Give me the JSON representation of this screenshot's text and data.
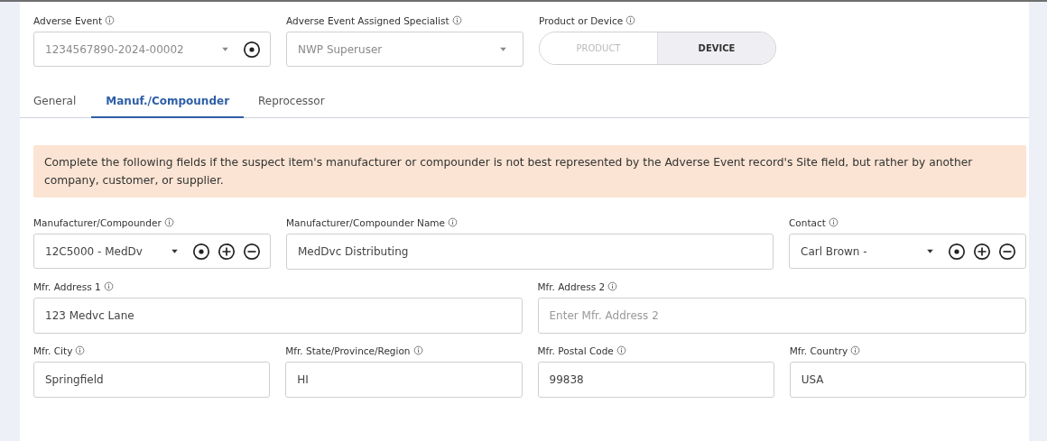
{
  "header_fields": [
    {
      "kind": "lookup",
      "label": "Adverse Event",
      "value": "1234567890-2024-00002",
      "disabled": true
    },
    {
      "kind": "select",
      "label": "Adverse Event Assigned Specialist",
      "value": "NWP Superuser",
      "disabled": true
    },
    {
      "kind": "toggle",
      "label": "Product or Device",
      "options": [
        {
          "label": "PRODUCT",
          "selected": false
        },
        {
          "label": "DEVICE",
          "selected": true
        }
      ]
    }
  ],
  "tabs": [
    {
      "label": "General",
      "selected": false
    },
    {
      "label": "Manuf./Compounder",
      "selected": true
    },
    {
      "label": "Reprocessor",
      "selected": false
    }
  ],
  "notice": "Complete the following fields if the suspect item's manufacturer or compounder is not best represented by the Adverse Event record's Site field, but rather by another company, customer, or supplier.",
  "form_rows": [
    [
      {
        "kind": "lookup-edit",
        "label": "Manufacturer/Compounder",
        "value": "12C5000 - MedDv"
      },
      {
        "kind": "text",
        "label": "Manufacturer/Compounder Name",
        "value": "MedDvc Distributing"
      },
      {
        "kind": "lookup-edit",
        "label": "Contact",
        "value": "Carl Brown -"
      }
    ],
    [
      {
        "kind": "text",
        "label": "Mfr. Address 1",
        "value": "123 Medvc Lane"
      },
      {
        "kind": "text",
        "label": "Mfr. Address 2",
        "placeholder": "Enter Mfr. Address 2"
      }
    ],
    [
      {
        "kind": "text",
        "label": "Mfr. City",
        "value": "Springfield"
      },
      {
        "kind": "text",
        "label": "Mfr. State/Province/Region",
        "value": "HI"
      },
      {
        "kind": "text",
        "label": "Mfr. Postal Code",
        "value": "99838"
      },
      {
        "kind": "text",
        "label": "Mfr. Country",
        "value": "USA"
      }
    ]
  ]
}
